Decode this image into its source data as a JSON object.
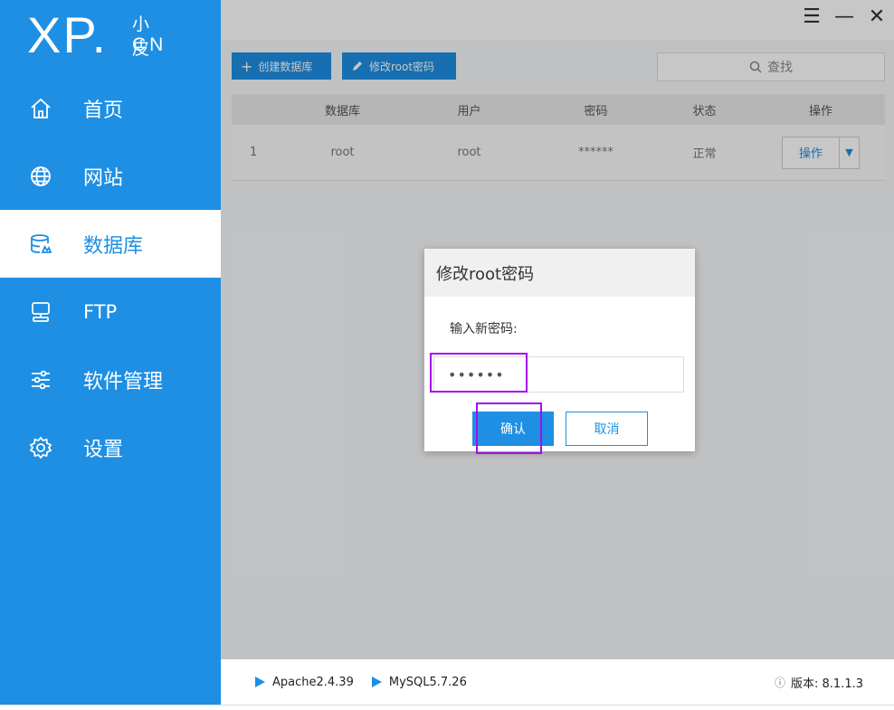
{
  "brand": {
    "logo_main": "XP.",
    "logo_cn": "小皮",
    "logo_domain": "CN"
  },
  "sidebar": {
    "items": [
      {
        "label": "首页",
        "icon": "home-icon"
      },
      {
        "label": "网站",
        "icon": "globe-icon"
      },
      {
        "label": "数据库",
        "icon": "database-icon",
        "active": true
      },
      {
        "label": "FTP",
        "icon": "server-icon"
      },
      {
        "label": "软件管理",
        "icon": "sliders-icon"
      },
      {
        "label": "设置",
        "icon": "gear-icon"
      }
    ]
  },
  "window_controls": {
    "menu": "☰",
    "minimize": "—",
    "close": "✕"
  },
  "toolbar": {
    "create_label": "创建数据库",
    "modify_label": "修改root密码",
    "search_placeholder": "查找"
  },
  "table": {
    "headers": [
      "",
      "数据库",
      "用户",
      "密码",
      "状态",
      "操作"
    ],
    "rows": [
      {
        "index": "1",
        "database": "root",
        "user": "root",
        "password": "******",
        "status": "正常",
        "action": "操作"
      }
    ]
  },
  "modal": {
    "title": "修改root密码",
    "label": "输入新密码:",
    "password_value": "••••••",
    "ok_label": "确认",
    "cancel_label": "取消"
  },
  "footer": {
    "services": [
      "Apache2.4.39",
      "MySQL5.7.26"
    ],
    "version_label": "版本: 8.1.1.3"
  },
  "colors": {
    "accent": "#1e8fe3",
    "highlight": "#a30ef0"
  }
}
